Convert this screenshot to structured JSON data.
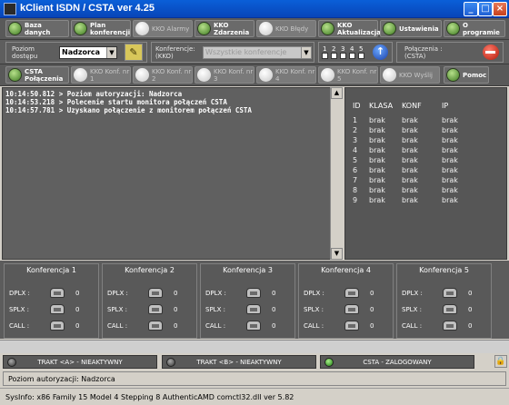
{
  "window": {
    "title": "kClient ISDN / CSTA ver  4.25",
    "min": "_",
    "max": "□",
    "close": "×"
  },
  "toolbar1": [
    {
      "label": "Baza danych",
      "enabled": true
    },
    {
      "label": "Plan konferencji",
      "enabled": true
    },
    {
      "label": "KKO Alarmy",
      "enabled": false
    },
    {
      "label": "KKO Zdarzenia",
      "enabled": true
    },
    {
      "label": "KKO Błędy",
      "enabled": false
    },
    {
      "label": "KKO Aktualizacja",
      "enabled": true
    },
    {
      "label": "Ustawienia",
      "enabled": true
    },
    {
      "label": "O programie",
      "enabled": true
    }
  ],
  "toolbar2": {
    "level_label": "Poziom dostępu",
    "level_value": "Nadzorca",
    "conf_label": "Konferencje: (KKO)",
    "conf_value": "Wszystkie konferencje",
    "numbers": [
      "1",
      "2",
      "3",
      "4",
      "5"
    ],
    "conn_label": "Połączenia : (CSTA)"
  },
  "toolbar3": [
    {
      "label": "CSTA Połączenia",
      "enabled": true
    },
    {
      "label": "KKO Konf. nr 1",
      "enabled": false
    },
    {
      "label": "KKO Konf. nr 2",
      "enabled": false
    },
    {
      "label": "KKO Konf. nr 3",
      "enabled": false
    },
    {
      "label": "KKO Konf. nr 4",
      "enabled": false
    },
    {
      "label": "KKO Konf. nr 5",
      "enabled": false
    },
    {
      "label": "KKO Wyślij",
      "enabled": false
    },
    {
      "label": "Pomoc",
      "enabled": true
    }
  ],
  "log": [
    "10:14:50.812 > Poziom autoryzacji: Nadzorca",
    "10:14:53.218 > Polecenie startu monitora połączeń CSTA",
    "10:14:57.781 > Uzyskano połączenie z monitorem połączeń CSTA"
  ],
  "ports": {
    "headers": [
      "ID",
      "KLASA",
      "KONF",
      "IP"
    ],
    "rows": [
      [
        "1",
        "brak",
        "brak",
        "brak"
      ],
      [
        "2",
        "brak",
        "brak",
        "brak"
      ],
      [
        "3",
        "brak",
        "brak",
        "brak"
      ],
      [
        "4",
        "brak",
        "brak",
        "brak"
      ],
      [
        "5",
        "brak",
        "brak",
        "brak"
      ],
      [
        "6",
        "brak",
        "brak",
        "brak"
      ],
      [
        "7",
        "brak",
        "brak",
        "brak"
      ],
      [
        "8",
        "brak",
        "brak",
        "brak"
      ],
      [
        "9",
        "brak",
        "brak",
        "brak"
      ]
    ]
  },
  "conferences": [
    {
      "title": "Konferencja 1",
      "dplx": "0",
      "splx": "0",
      "call": "0"
    },
    {
      "title": "Konferencja 2",
      "dplx": "0",
      "splx": "0",
      "call": "0"
    },
    {
      "title": "Konferencja 3",
      "dplx": "0",
      "splx": "0",
      "call": "0"
    },
    {
      "title": "Konferencja 4",
      "dplx": "0",
      "splx": "0",
      "call": "0"
    },
    {
      "title": "Konferencja 5",
      "dplx": "0",
      "splx": "0",
      "call": "0"
    }
  ],
  "conf_keys": {
    "dplx": "DPLX :",
    "splx": "SPLX :",
    "call": "CALL :"
  },
  "trakts": [
    {
      "label": "TRAKT <A> - NIEAKTYWNY",
      "ok": false
    },
    {
      "label": "TRAKT <B> - NIEAKTYWNY",
      "ok": false
    },
    {
      "label": "CSTA - ZALOGOWANY",
      "ok": true
    }
  ],
  "auth_text": "Poziom autoryzacji: Nadzorca",
  "sysinfo": "SysInfo: x86 Family 15 Model 4 Stepping 8 AuthenticAMD    comctl32.dll ver 5.82",
  "colors": {
    "titlebar": "#0a5fd8",
    "panel_dark": "#5c5c5c",
    "status_ok": "#1c7a10"
  }
}
